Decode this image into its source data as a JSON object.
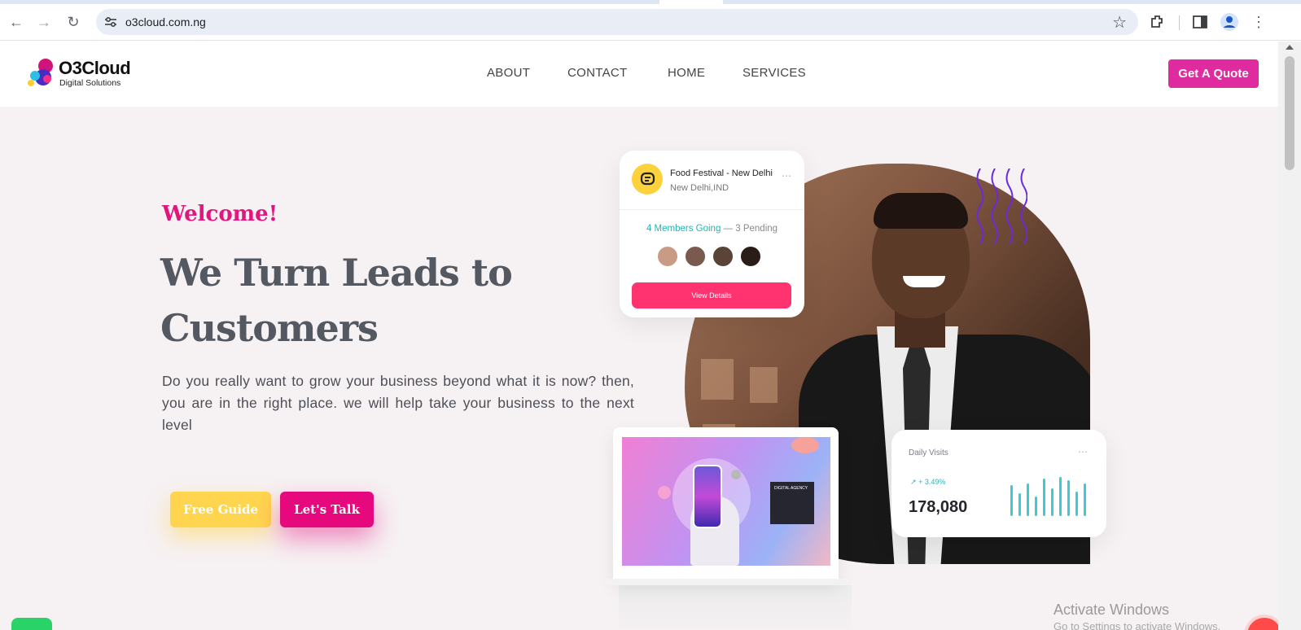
{
  "browser": {
    "url": "o3cloud.com.ng",
    "back_icon": "back-arrow-icon",
    "forward_icon": "forward-arrow-icon",
    "reload_icon": "reload-icon"
  },
  "header": {
    "logo_text": "O3Cloud",
    "logo_sub": "Digital Solutions",
    "nav": [
      "ABOUT",
      "CONTACT",
      "HOME",
      "SERVICES"
    ],
    "quote_label": "Get A Quote"
  },
  "hero": {
    "welcome": "Welcome!",
    "headline": "We Turn Leads to Customers",
    "description": "Do you really want to grow your business beyond what it is now? then, you are in the right place. we will help take your business to the next level",
    "free_guide": "Free Guide",
    "lets_talk": "Let's Talk"
  },
  "event_card": {
    "title": "Food Festival - New Delhi",
    "location": "New Delhi,IND",
    "members_going": "4 Members Going",
    "pending": "— 3 Pending",
    "button": "View Details"
  },
  "visits_card": {
    "title": "Daily Visits",
    "trend": "+ 3.49%",
    "value": "178,080"
  },
  "laptop": {
    "agency_label": "DIGITAL AGENCY"
  },
  "watermark": {
    "line1": "Activate Windows",
    "line2": "Go to Settings to activate Windows."
  },
  "colors": {
    "brand_pink": "#e02a9f",
    "accent_magenta": "#e6097d",
    "accent_yellow": "#ffd54f",
    "teal": "#3ccbd3"
  }
}
